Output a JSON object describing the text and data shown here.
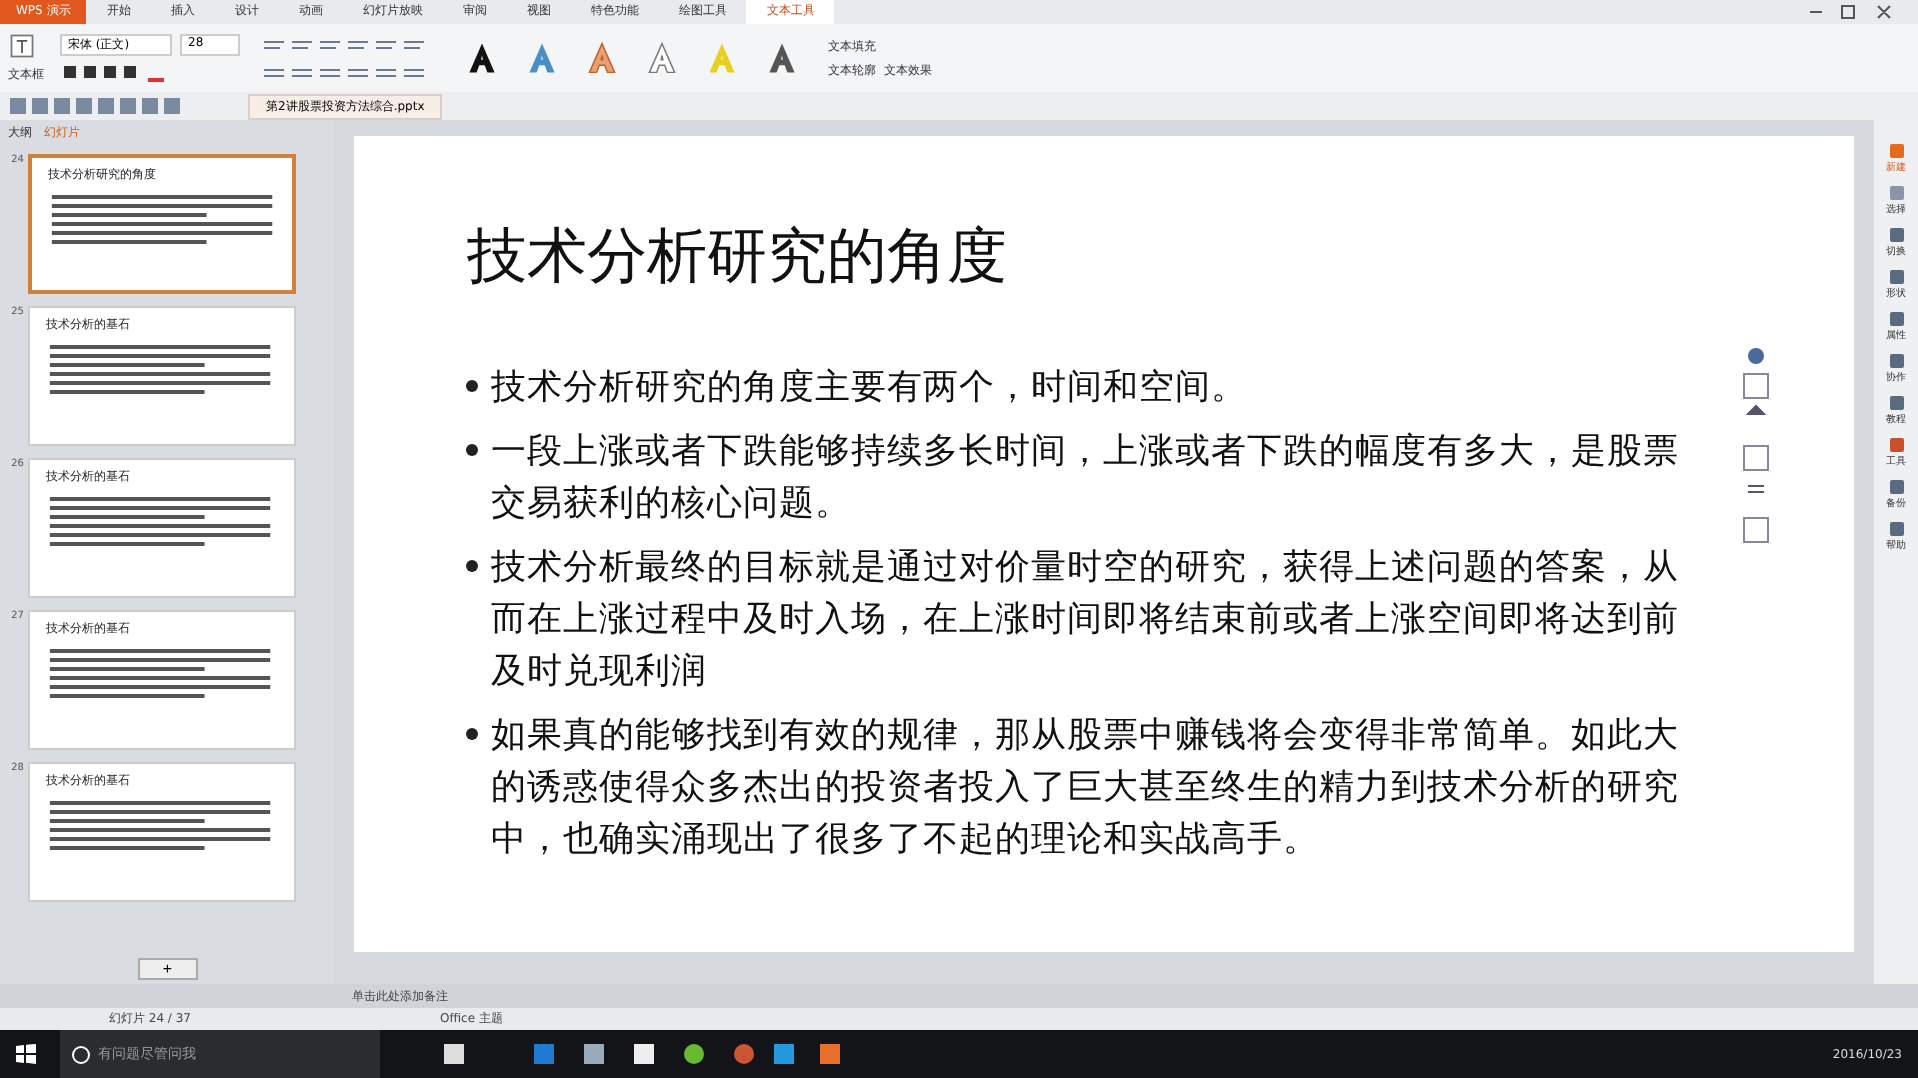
{
  "app": {
    "name": "WPS 演示"
  },
  "menu_tabs": [
    {
      "label": "开始",
      "selected": false
    },
    {
      "label": "插入",
      "selected": false
    },
    {
      "label": "设计",
      "selected": false
    },
    {
      "label": "动画",
      "selected": false
    },
    {
      "label": "幻灯片放映",
      "selected": false
    },
    {
      "label": "审阅",
      "selected": false
    },
    {
      "label": "视图",
      "selected": false
    },
    {
      "label": "特色功能",
      "selected": false
    },
    {
      "label": "绘图工具",
      "selected": false
    },
    {
      "label": "文本工具",
      "selected": true
    }
  ],
  "toolbar": {
    "textbox_label": "文本框",
    "font": "宋体 (正文)",
    "font_size": "28",
    "fill_label": "文本填充",
    "outline_label": "文本轮廓",
    "effect_label": "文本效果"
  },
  "document_tab": {
    "title": "第2讲股票投资方法综合.pptx"
  },
  "panel_tabs": [
    {
      "label": "大纲",
      "selected": false
    },
    {
      "label": "幻灯片",
      "selected": true
    }
  ],
  "thumbnails": [
    {
      "number": "24",
      "title": "技术分析研究的角度",
      "selected": true
    },
    {
      "number": "25",
      "title": "技术分析的基石",
      "selected": false
    },
    {
      "number": "26",
      "title": "技术分析的基石",
      "selected": false
    },
    {
      "number": "27",
      "title": "技术分析的基石",
      "selected": false
    },
    {
      "number": "28",
      "title": "技术分析的基石",
      "selected": false
    }
  ],
  "add_slide_button": "+",
  "slide": {
    "title": "技术分析研究的角度",
    "bullets": [
      "技术分析研究的角度主要有两个，时间和空间。",
      "一段上涨或者下跌能够持续多长时间，上涨或者下跌的幅度有多大，是股票交易获利的核心问题。",
      "技术分析最终的目标就是通过对价量时空的研究，获得上述问题的答案，从而在上涨过程中及时入场，在上涨时间即将结束前或者上涨空间即将达到前及时兑现利润",
      "如果真的能够找到有效的规律，那从股票中赚钱将会变得非常简单。如此大的诱惑使得众多杰出的投资者投入了巨大甚至终生的精力到技术分析的研究中，也确实涌现出了很多了不起的理论和实战高手。"
    ]
  },
  "right_sidebar": [
    {
      "label": "新建",
      "selected": true
    },
    {
      "label": "选择",
      "selected": false
    },
    {
      "label": "切换",
      "selected": false
    },
    {
      "label": "形状",
      "selected": false
    },
    {
      "label": "属性",
      "selected": false
    },
    {
      "label": "协作",
      "selected": false
    },
    {
      "label": "教程",
      "selected": false
    },
    {
      "label": "工具",
      "selected": false
    },
    {
      "label": "备份",
      "selected": false
    },
    {
      "label": "帮助",
      "selected": false
    }
  ],
  "notes_placeholder": "单击此处添加备注",
  "status_bar": {
    "slide_count": "幻灯片 24 / 37",
    "theme": "Office 主题"
  },
  "taskbar": {
    "search_placeholder": "有问题尽管问我",
    "date": "2016/10/23"
  }
}
